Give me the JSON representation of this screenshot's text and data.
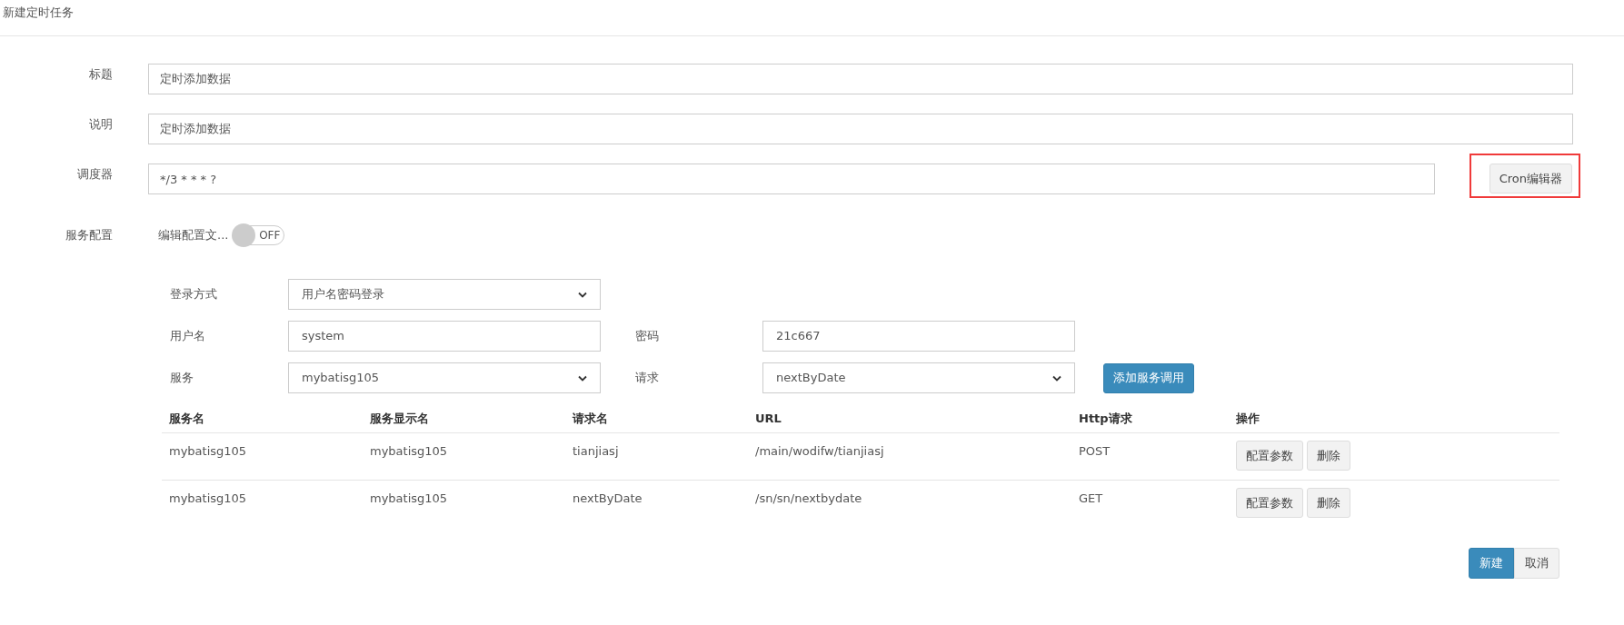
{
  "page_title": "新建定时任务",
  "fields": [
    {
      "label": "标题",
      "value": "定时添加数据"
    },
    {
      "label": "说明",
      "value": "定时添加数据"
    },
    {
      "label": "调度器",
      "value": "*/3 * * * ?",
      "button": "Cron编辑器",
      "highlighted": true
    }
  ],
  "service_config": {
    "label": "服务配置",
    "option_label": "编辑配置文...",
    "toggle": {
      "on": false,
      "text": "OFF"
    }
  },
  "service_form": [
    {
      "kind": "select",
      "label": "登录方式",
      "value": "用户名密码登录"
    },
    {
      "kind": "pair",
      "label": "用户名",
      "value": "system",
      "label_2": "密码",
      "value_2": "21c667"
    },
    {
      "kind": "pair_select",
      "label": "服务",
      "value": "mybatisg105",
      "label_2": "请求",
      "value_2": "nextByDate",
      "button": "添加服务调用"
    }
  ],
  "table": {
    "columns": [
      "服务名",
      "服务显示名",
      "请求名",
      "URL",
      "Http请求",
      "操作"
    ],
    "rows": [
      {
        "cells": [
          "mybatisg105",
          "mybatisg105",
          "tianjiasj",
          "/main/wodifw/tianjiasj",
          "POST"
        ],
        "actions": [
          "配置参数",
          "删除"
        ]
      },
      {
        "cells": [
          "mybatisg105",
          "mybatisg105",
          "nextByDate",
          "/sn/sn/nextbydate",
          "GET"
        ],
        "actions": [
          "配置参数",
          "删除"
        ]
      }
    ]
  },
  "buttons": [
    {
      "label": "新建",
      "kind": "primary"
    },
    {
      "label": "取消",
      "kind": "default"
    }
  ]
}
